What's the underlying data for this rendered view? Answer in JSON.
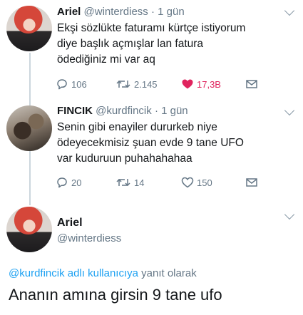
{
  "tweets": [
    {
      "name": "Ariel",
      "handle": "@winterdiess",
      "dot": "·",
      "time": "1 gün",
      "lines": [
        "Ekşi sözlükte faturamı kürtçe istiyorum",
        "diye başlık açmışlar lan fatura",
        "ödediğiniz mi var aq"
      ],
      "replies": "106",
      "retweets": "2.145",
      "likes": "17,3B",
      "liked": true
    },
    {
      "name": "FINCIK",
      "handle": "@kurdfincik",
      "dot": "·",
      "time": "1 gün",
      "lines": [
        "Senin gibi enayiler dururkeb niye",
        "ödeyecekmisiz şuan evde 9 tane UFO",
        "var kuduruun puhahahahaa"
      ],
      "replies": "20",
      "retweets": "14",
      "likes": "150",
      "liked": false
    }
  ],
  "detail": {
    "name": "Ariel",
    "handle": "@winterdiess",
    "reply_mention": "@kurdfincik adlı kullanıcıya",
    "reply_rest": "yanıt olarak",
    "text": "Ananın amına girsin 9 tane ufo"
  },
  "icons": {
    "reply": "reply-icon",
    "retweet": "retweet-icon",
    "like": "heart-icon",
    "message": "envelope-icon",
    "more": "chevron-down-icon"
  },
  "colors": {
    "like_active": "#e0245e",
    "link": "#1da1f2",
    "secondary_text": "#657786"
  }
}
